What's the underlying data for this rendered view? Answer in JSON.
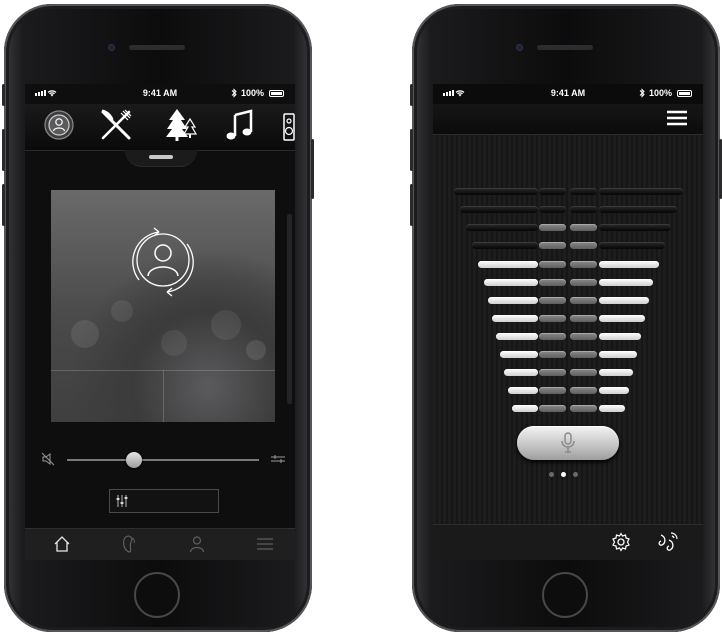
{
  "left_phone": {
    "status": {
      "time": "9:41 AM",
      "battery": "100%"
    },
    "top_icons": [
      "user-sync-icon",
      "fork-knife-icon",
      "tree-icon",
      "music-note-icon",
      "speaker-icon"
    ],
    "panel_icon": "user-sync-icon",
    "volume": {
      "level": 0.35,
      "mute_icon": "mute-icon",
      "tone_icon": "tone-adjust-icon"
    },
    "equalizer_button_icon": "equalizer-icon",
    "bottom_nav": [
      "home-icon",
      "hearing-aid-icon",
      "profile-icon",
      "menu-icon"
    ]
  },
  "right_phone": {
    "status": {
      "time": "9:41 AM",
      "battery": "100%"
    },
    "menu_icon": "hamburger-menu-icon",
    "mic_button_icon": "microphone-icon",
    "page_dots": {
      "count": 3,
      "active": 1
    },
    "bottom_icons": [
      "settings-gear-icon",
      "wireless-link-icon"
    ]
  }
}
